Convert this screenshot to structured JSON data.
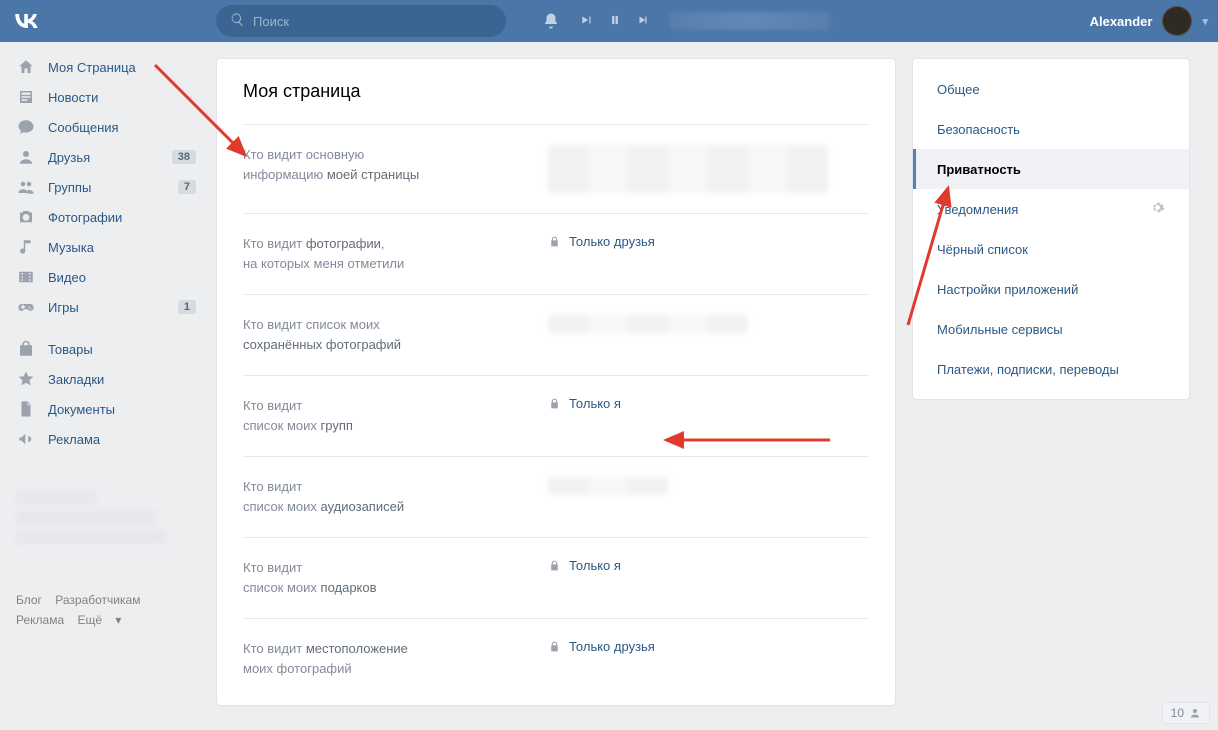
{
  "header": {
    "search_placeholder": "Поиск",
    "username": "Alexander"
  },
  "sidebar": {
    "items": [
      {
        "icon": "home",
        "label": "Моя Страница",
        "badge": ""
      },
      {
        "icon": "news",
        "label": "Новости",
        "badge": ""
      },
      {
        "icon": "chat",
        "label": "Сообщения",
        "badge": ""
      },
      {
        "icon": "user",
        "label": "Друзья",
        "badge": "38"
      },
      {
        "icon": "group",
        "label": "Группы",
        "badge": "7"
      },
      {
        "icon": "photo",
        "label": "Фотографии",
        "badge": ""
      },
      {
        "icon": "music",
        "label": "Музыка",
        "badge": ""
      },
      {
        "icon": "video",
        "label": "Видео",
        "badge": ""
      },
      {
        "icon": "game",
        "label": "Игры",
        "badge": "1"
      },
      {
        "icon": "",
        "label": "",
        "badge": ""
      },
      {
        "icon": "bag",
        "label": "Товары",
        "badge": ""
      },
      {
        "icon": "star",
        "label": "Закладки",
        "badge": ""
      },
      {
        "icon": "doc",
        "label": "Документы",
        "badge": ""
      },
      {
        "icon": "ads",
        "label": "Реклама",
        "badge": ""
      }
    ],
    "footer_links": {
      "blog": "Блог",
      "devs": "Разработчикам",
      "ads": "Реклама",
      "more": "Ещё"
    }
  },
  "settings": {
    "title": "Моя страница",
    "rows": [
      {
        "label_pre": "Кто видит основную",
        "label_post": "информацию ",
        "label_bold": "моей страницы",
        "value": "",
        "locked": false,
        "blur": "big"
      },
      {
        "label_pre": "Кто видит ",
        "label_bold": "фотографии",
        "label_post2": ",\nна которых меня отметили",
        "value": "Только друзья",
        "locked": true,
        "blur": ""
      },
      {
        "label_pre": "Кто видит список моих",
        "label_bold": "сохранённых фотографий",
        "value": "",
        "locked": false,
        "blur": "small"
      },
      {
        "label_pre": "Кто видит",
        "label_post": "список моих ",
        "label_bold": "групп",
        "value": "Только я",
        "locked": true,
        "blur": ""
      },
      {
        "label_pre": "Кто видит",
        "label_post": "список моих ",
        "label_bold": "аудиозаписей",
        "value": "",
        "locked": false,
        "blur": "sm2"
      },
      {
        "label_pre": "Кто видит",
        "label_post": "список моих ",
        "label_bold": "подарков",
        "value": "Только я",
        "locked": true,
        "blur": ""
      },
      {
        "label_pre": "Кто видит ",
        "label_bold": "местоположение",
        "label_post2": "\nмоих фотографий",
        "value": "Только друзья",
        "locked": true,
        "blur": ""
      }
    ]
  },
  "right_nav": {
    "items": [
      "Общее",
      "Безопасность",
      "Приватность",
      "Уведомления",
      "Чёрный список",
      "Настройки приложений",
      "Мобильные сервисы",
      "Платежи, подписки, переводы"
    ],
    "active_index": 2,
    "gear_index": 3
  },
  "bottom_counter": "10"
}
